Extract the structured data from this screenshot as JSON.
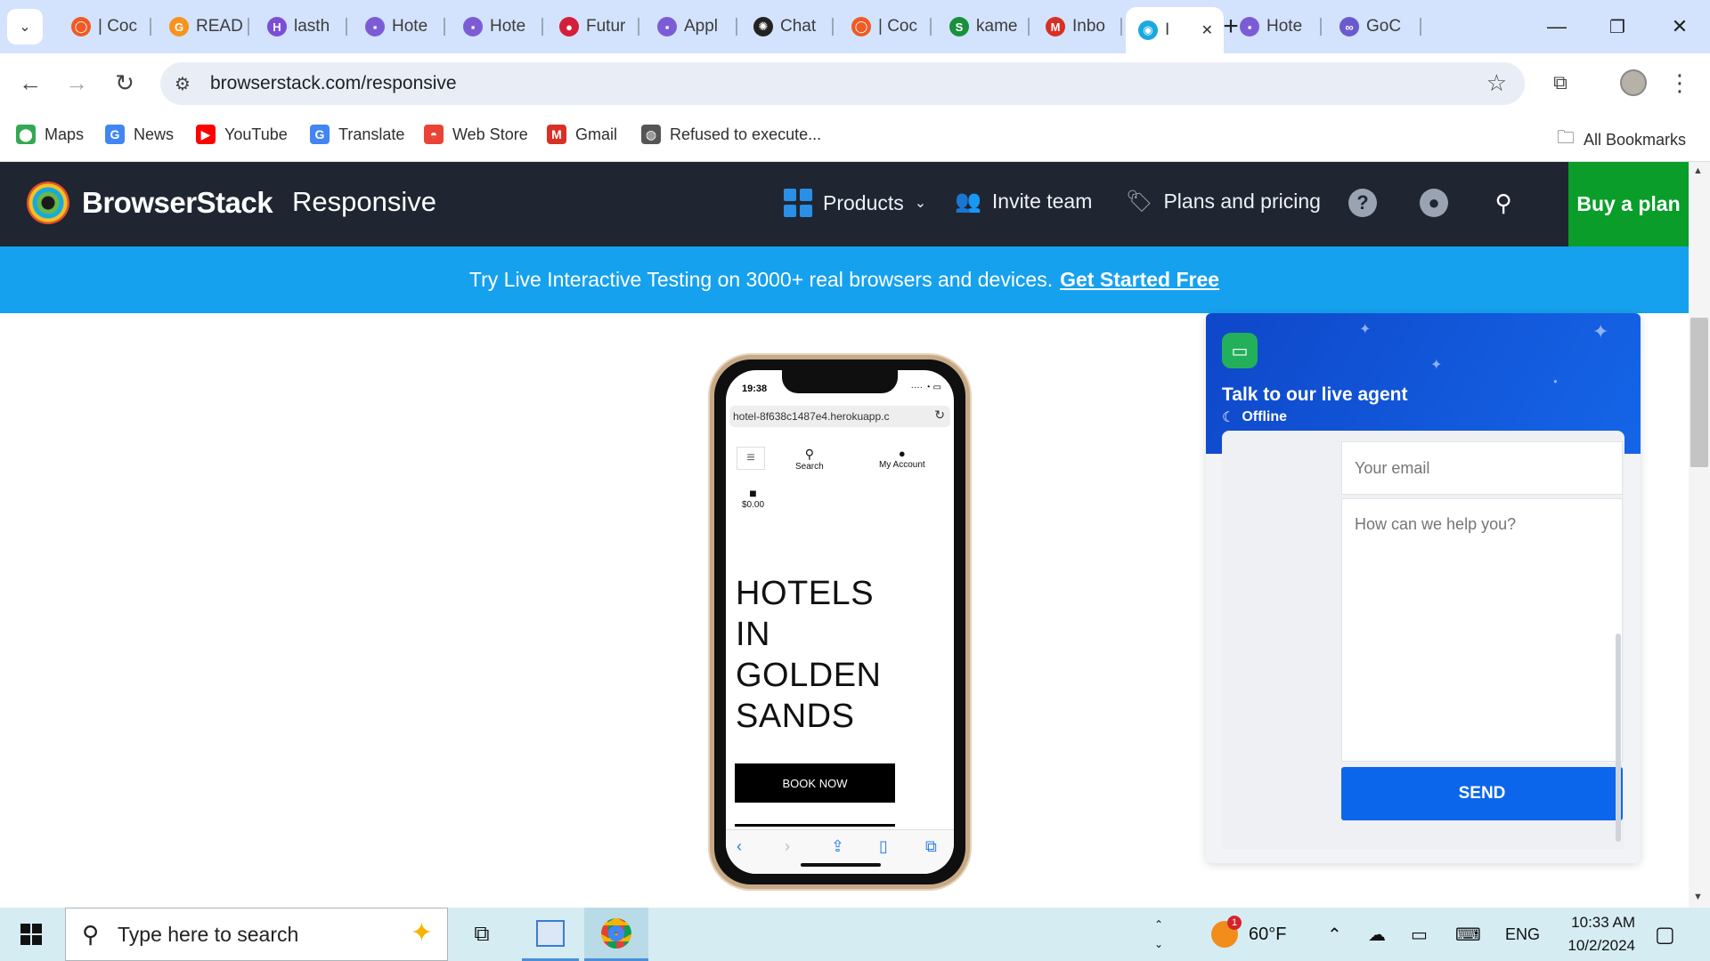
{
  "browser": {
    "tabs": [
      {
        "title": "| Coc",
        "color": "#f05a24",
        "glyph": "◯",
        "active": false
      },
      {
        "title": "READ",
        "color": "#f7931e",
        "glyph": "G",
        "active": false
      },
      {
        "title": "lasth",
        "color": "#7a4fd6",
        "glyph": "H",
        "active": false
      },
      {
        "title": "Hote",
        "color": "#7b5cd6",
        "glyph": "▪",
        "active": false
      },
      {
        "title": "Hote",
        "color": "#7b5cd6",
        "glyph": "▪",
        "active": false
      },
      {
        "title": "Futur",
        "color": "#d41f3a",
        "glyph": "●",
        "active": false
      },
      {
        "title": "Appl",
        "color": "#7b5cd6",
        "glyph": "▪",
        "active": false
      },
      {
        "title": "Chat",
        "color": "#222222",
        "glyph": "✺",
        "active": false
      },
      {
        "title": "| Coc",
        "color": "#f05a24",
        "glyph": "◯",
        "active": false
      },
      {
        "title": "kame",
        "color": "#1a8f3c",
        "glyph": "S",
        "active": false
      },
      {
        "title": "Inbo",
        "color": "#d93025",
        "glyph": "M",
        "active": false
      },
      {
        "title": "I",
        "color": "#18a9e0",
        "glyph": "◉",
        "active": true
      },
      {
        "title": "Hote",
        "color": "#7b5cd6",
        "glyph": "▪",
        "active": false
      },
      {
        "title": "GoC",
        "color": "#6a5acd",
        "glyph": "∞",
        "active": false
      }
    ],
    "new_tab": "+",
    "minimize": "—",
    "restore": "❐",
    "close": "✕",
    "url": "browserstack.com/responsive",
    "bookmarks": [
      {
        "label": "Maps",
        "color": "#34a853",
        "glyph": "⬤"
      },
      {
        "label": "News",
        "color": "#4285f4",
        "glyph": "G"
      },
      {
        "label": "YouTube",
        "color": "#ff0000",
        "glyph": "▶"
      },
      {
        "label": "Translate",
        "color": "#4285f4",
        "glyph": "G"
      },
      {
        "label": "Web Store",
        "color": "#ea4335",
        "glyph": "◓"
      },
      {
        "label": "Gmail",
        "color": "#d93025",
        "glyph": "M"
      },
      {
        "label": "Refused to execute...",
        "color": "#555555",
        "glyph": "◍"
      }
    ],
    "all_bookmarks": "All Bookmarks"
  },
  "site": {
    "brand": "BrowserStack",
    "product": "Responsive",
    "nav": {
      "products": "Products",
      "invite": "Invite team",
      "pricing": "Plans and pricing"
    },
    "buy": "Buy a plan",
    "promo_text": "Try Live Interactive Testing on 3000+ real browsers and devices.",
    "promo_link": "Get Started Free"
  },
  "phone": {
    "time": "19:38",
    "url": "hotel-8f638c1487e4.herokuapp.c",
    "search": "Search",
    "account": "My Account",
    "cart": "$0.00",
    "hero": [
      "HOTELS",
      "IN",
      "GOLDEN",
      "SANDS"
    ],
    "book": "BOOK NOW"
  },
  "chat": {
    "title": "Talk to our live agent",
    "status": "Offline",
    "email_placeholder": "Your email",
    "message_placeholder": "How can we help you?",
    "send": "SEND"
  },
  "taskbar": {
    "search_placeholder": "Type here to search",
    "weather": "60°F",
    "weather_badge": "1",
    "lang": "ENG",
    "time": "10:33 AM",
    "date": "10/2/2024"
  }
}
